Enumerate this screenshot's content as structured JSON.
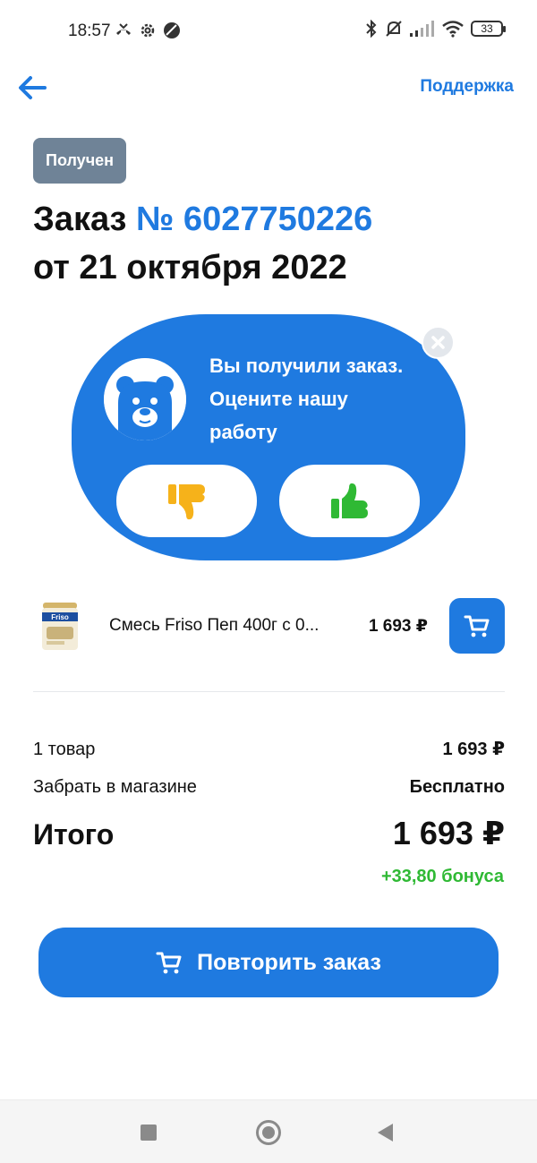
{
  "status_bar": {
    "time": "18:57",
    "battery": "33",
    "icons": [
      "missed-call-icon",
      "settings-icon",
      "vpn-icon",
      "bluetooth-icon",
      "mute-icon",
      "signal-icon",
      "wifi-icon",
      "battery-icon"
    ]
  },
  "header": {
    "back_icon": "arrow-left-icon",
    "support_label": "Поддержка"
  },
  "order": {
    "status": "Получен",
    "title_prefix": "Заказ",
    "number": "№ 6027750226",
    "date_line": "от 21 октября 2022"
  },
  "rating": {
    "line1": "Вы получили заказ.",
    "line2": "Оцените нашу",
    "line3": "работу",
    "dislike_icon": "thumbs-down-icon",
    "like_icon": "thumbs-up-icon",
    "close_icon": "close-icon"
  },
  "product": {
    "brand_on_pack": "Friso",
    "name": "Смесь Friso Пеп 400г с 0...",
    "price": "1 693 ₽",
    "cart_icon": "cart-icon"
  },
  "summary": {
    "items_label": "1 товар",
    "items_value": "1 693 ₽",
    "delivery_label": "Забрать в магазине",
    "delivery_value": "Бесплатно",
    "total_label": "Итого",
    "total_value": "1 693 ₽",
    "bonus": "+33,80 бонуса"
  },
  "repeat": {
    "label": "Повторить заказ"
  },
  "colors": {
    "accent": "#1f7ae0",
    "status_chip": "#6f8397",
    "bonus_green": "#2fb934",
    "thumb_down": "#f6b21a",
    "thumb_up": "#2fb934"
  }
}
